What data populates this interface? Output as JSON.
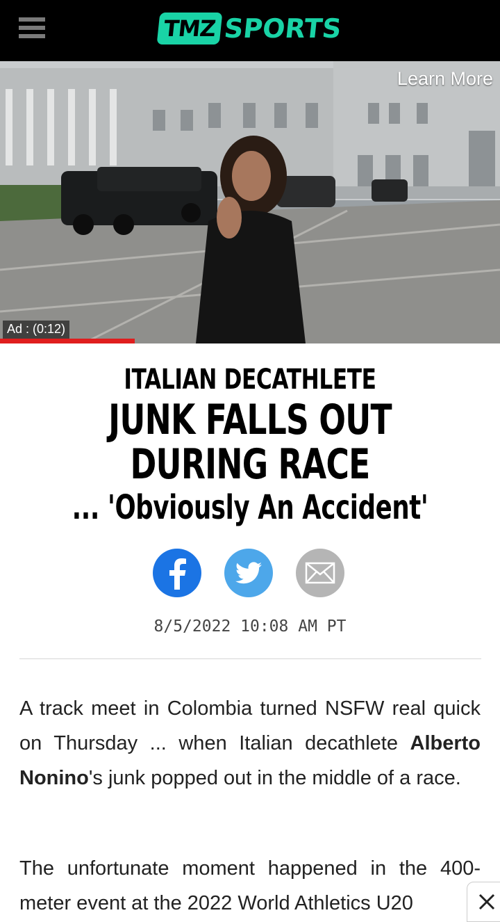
{
  "header": {
    "logo_tmz": "TMZ",
    "logo_sports": "SPORTS"
  },
  "video_ad": {
    "learn_more": "Learn More",
    "ad_label": "Ad : (0:12)",
    "progress_fraction": 0.27
  },
  "article": {
    "kicker": "ITALIAN DECATHLETE",
    "title": "JUNK FALLS OUT DURING RACE",
    "subtitle": "... 'Obviously An Accident'",
    "timestamp": "8/5/2022 10:08 AM PT",
    "p1_before": "A track meet in Colombia turned NSFW real quick on Thursday ... when Italian decathlete ",
    "p1_name": "Alberto Nonino",
    "p1_after": "'s junk popped out in the middle of a race.",
    "p2": "The unfortunate moment happened in the 400-meter event at the 2022 World Athletics U20"
  },
  "share": {
    "facebook": "facebook-icon",
    "twitter": "twitter-icon",
    "email": "email-icon"
  },
  "colors": {
    "brand": "#19d3a6",
    "facebook": "#1b74e4",
    "twitter": "#4da7ea",
    "email": "#b5b5b5",
    "progress": "#e01e1e"
  }
}
